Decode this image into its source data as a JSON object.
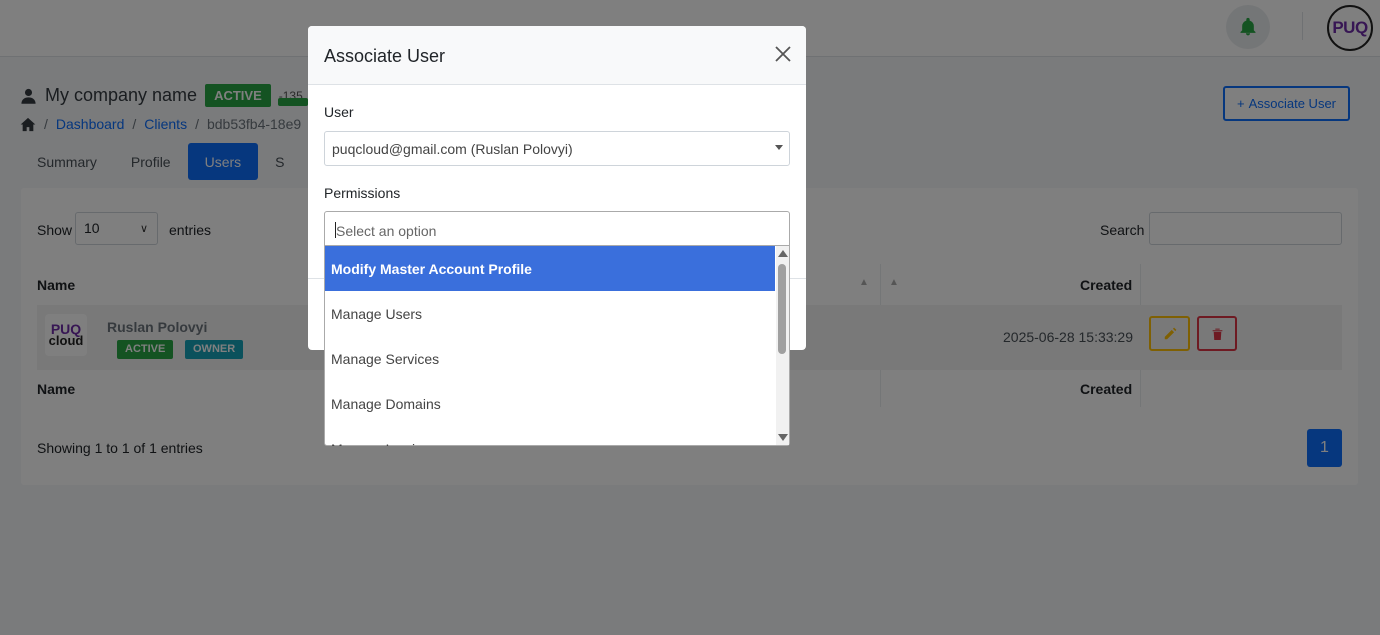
{
  "header": {
    "bell_icon": "bell-icon",
    "logo_text": "PUQ"
  },
  "client": {
    "name": "My company name",
    "status": "ACTIVE",
    "balance": "-135"
  },
  "breadcrumb": {
    "home_icon": "home-icon",
    "items": [
      "Dashboard",
      "Clients",
      "bdb53fb4-18e9"
    ]
  },
  "actions": {
    "associate_user": "Associate User"
  },
  "tabs": [
    "Summary",
    "Profile",
    "Users",
    "S"
  ],
  "table": {
    "show_label": "Show",
    "entries_value": "10",
    "entries_label": "entries",
    "search_label": "Search",
    "columns": {
      "name": "Name",
      "created": "Created"
    },
    "rows": [
      {
        "logo_top": "PUQ",
        "logo_bottom": "cloud",
        "name": "Ruslan Polovyi",
        "badges": [
          "ACTIVE",
          "OWNER"
        ],
        "created": "2025-06-28 15:33:29"
      }
    ],
    "showing": "Showing 1 to 1 of 1 entries",
    "page": "1"
  },
  "modal": {
    "title": "Associate User",
    "user_label": "User",
    "user_value": "puqcloud@gmail.com (Ruslan Polovyi)",
    "permissions_label": "Permissions",
    "permissions_placeholder": "Select an option",
    "options": [
      "Modify Master Account Profile",
      "Manage Users",
      "Manage Services",
      "Manage Domains",
      "Manage Invoices"
    ]
  },
  "colors": {
    "primary": "#0d6efd",
    "success": "#28a745",
    "info": "#17a2b8",
    "warning": "#ffc107",
    "danger": "#dc3545",
    "highlight": "#3a6fdc"
  }
}
